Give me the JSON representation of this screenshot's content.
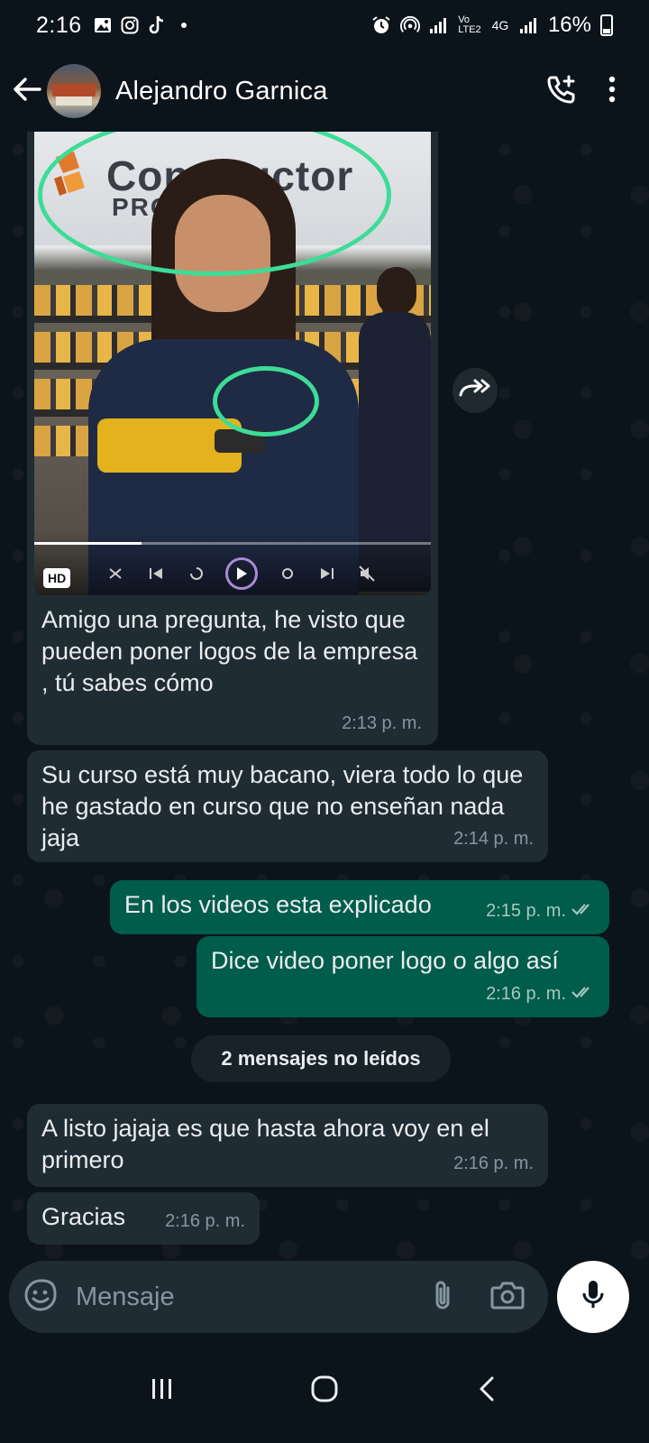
{
  "status_bar": {
    "time": "2:16",
    "battery": "16%",
    "network_label": "4G"
  },
  "header": {
    "contact_name": "Alejandro Garnica"
  },
  "media_message": {
    "store_logo": "Constructor",
    "store_logo_sub": "PRO STORE",
    "hd_badge": "HD",
    "video_progress": 0.27,
    "caption": "Amigo una pregunta, he visto que pueden poner logos de la empresa , tú sabes cómo",
    "time": "2:13 p. m."
  },
  "messages": [
    {
      "id": "m2",
      "direction": "in",
      "text": "Su curso está muy bacano, viera todo lo que he gastado en curso que no enseñan nada jaja",
      "time": "2:14 p. m."
    },
    {
      "id": "m3",
      "direction": "out",
      "text": "En los videos esta explicado",
      "time": "2:15 p. m.",
      "status": "read"
    },
    {
      "id": "m4",
      "direction": "out",
      "text": "Dice video poner logo o algo así",
      "time": "2:16 p. m.",
      "status": "read"
    },
    {
      "id": "m5",
      "direction": "in",
      "text": "A listo jajaja es que hasta ahora voy en el primero",
      "time": "2:16 p. m."
    },
    {
      "id": "m6",
      "direction": "in",
      "text": "Gracias",
      "time": "2:16 p. m."
    }
  ],
  "unread_divider": "2 mensajes no leídos",
  "input": {
    "placeholder": "Mensaje"
  },
  "icons": {
    "back": "back-arrow-icon",
    "call": "add-call-icon",
    "menu": "more-vert-icon",
    "forward": "forward-icon",
    "emoji": "sticker-icon",
    "attach": "paperclip-icon",
    "camera": "camera-icon",
    "mic": "mic-icon"
  },
  "colors": {
    "background": "#0b141a",
    "incoming_bubble": "#202c33",
    "outgoing_bubble": "#005c4b",
    "read_tick": "#53bdeb",
    "annotation": "#3ddc97"
  }
}
